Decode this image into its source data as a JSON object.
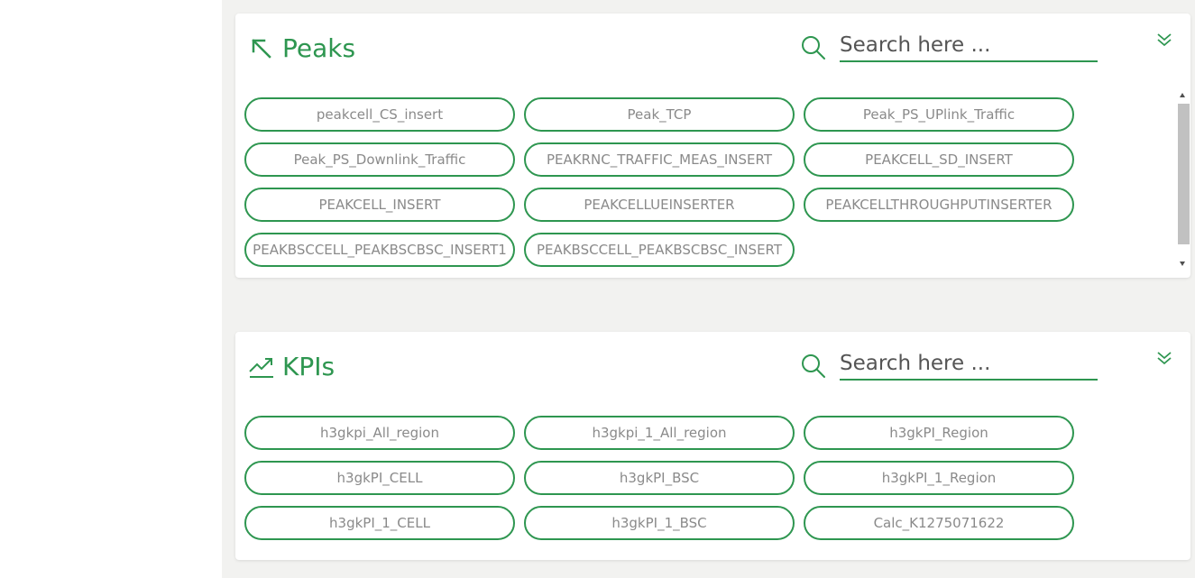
{
  "peaks": {
    "title": "Peaks",
    "title_icon": "arrow-up-left-icon",
    "search_placeholder": "Search here ...",
    "items": [
      "peakcell_CS_insert",
      "Peak_TCP",
      "Peak_PS_UPlink_Traffic",
      "Peak_PS_Downlink_Traffic",
      "PEAKRNC_TRAFFIC_MEAS_INSERT",
      "PEAKCELL_SD_INSERT",
      "PEAKCELL_INSERT",
      "PEAKCELLUEINSERTER",
      "PEAKCELLTHROUGHPUTINSERTER",
      "PEAKBSCCELL_PEAKBSCBSC_INSERT1",
      "PEAKBSCCELL_PEAKBSCBSC_INSERT"
    ]
  },
  "kpis": {
    "title": "KPIs",
    "title_icon": "trending-up-icon",
    "search_placeholder": "Search here ...",
    "items": [
      "h3gkpi_All_region",
      "h3gkpi_1_All_region",
      "h3gkPI_Region",
      "h3gkPI_CELL",
      "h3gkPI_BSC",
      "h3gkPI_1_Region",
      "h3gkPI_1_CELL",
      "h3gkPI_1_BSC",
      "Calc_K1275071622"
    ]
  },
  "colors": {
    "accent": "#2e9650",
    "chip_text": "#8a8a8a",
    "background": "#f2f2f0"
  }
}
